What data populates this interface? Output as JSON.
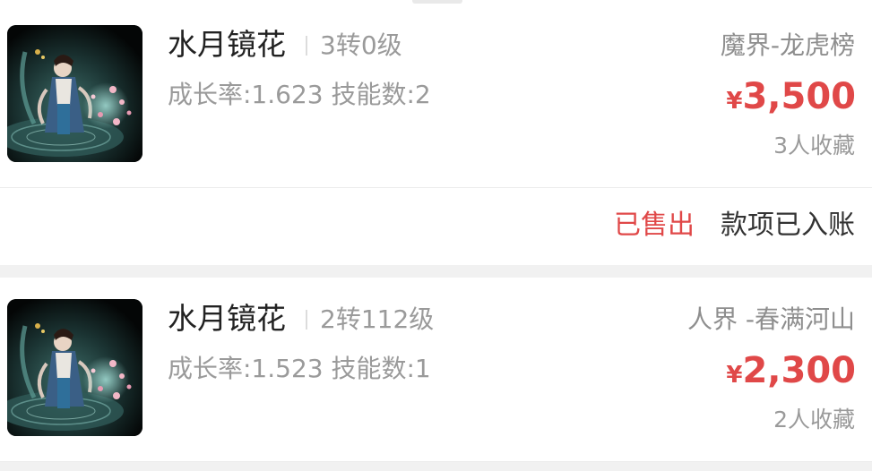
{
  "listings": [
    {
      "name": "水月镜花",
      "level": "3转0级",
      "stats": "成长率:1.623 技能数:2",
      "server": "魔界-龙虎榜",
      "price_symbol": "¥",
      "price": "3,500",
      "favorites": "3人收藏",
      "icon": "pet-portrait-icon"
    },
    {
      "name": "水月镜花",
      "level": "2转112级",
      "stats": "成长率:1.523 技能数:1",
      "server": "人界 -春满河山",
      "price_symbol": "¥",
      "price": "2,300",
      "favorites": "2人收藏",
      "icon": "pet-portrait-icon"
    }
  ],
  "order_status": {
    "sold": "已售出",
    "payment": "款项已入账"
  },
  "colors": {
    "accent_red": "#e04848",
    "title": "#222222",
    "muted": "#9a9a9a",
    "separator": "#f1f1f1"
  }
}
